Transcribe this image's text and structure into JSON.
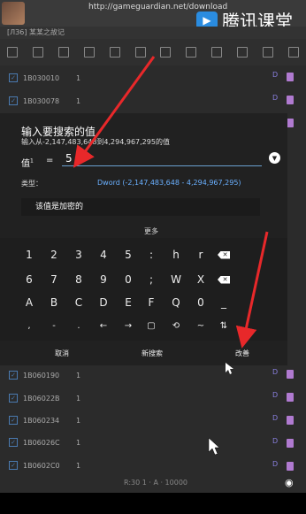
{
  "header": {
    "url": "http://gameguardian.net/download",
    "brand": "腾讯课堂",
    "breadcrumb": "[ЛЗ6] 某某之故记"
  },
  "background_rows": {
    "top": [
      {
        "addr": "1B030010",
        "val": "1"
      },
      {
        "addr": "1B030078",
        "val": "1"
      }
    ],
    "bottom": [
      {
        "addr": "1B060190",
        "val": "1"
      },
      {
        "addr": "1B06022B",
        "val": "1"
      },
      {
        "addr": "1B060234",
        "val": "1"
      },
      {
        "addr": "1B06026C",
        "val": "1"
      },
      {
        "addr": "1B0602C0",
        "val": "1"
      }
    ],
    "side_letter": "D"
  },
  "status": {
    "count": "R:30 1 · A · 10000"
  },
  "dialog": {
    "title": "输入要搜索的值",
    "subtitle": "输入从-2,147,483,648到4,294,967,295的值",
    "value_label": "值",
    "value_sup": "1",
    "equals": "=",
    "value": "5",
    "type_label": "类型：",
    "type_value": "Dword (-2,147,483,648 - 4,294,967,295)",
    "encrypted_label": "该值是加密的",
    "more_label": "更多",
    "keypad_rows": [
      [
        "1",
        "2",
        "3",
        "4",
        "5",
        ":",
        "h",
        "r",
        "⌫"
      ],
      [
        "6",
        "7",
        "8",
        "9",
        "0",
        ";",
        "W",
        "X",
        "⌫"
      ],
      [
        "A",
        "B",
        "C",
        "D",
        "E",
        "F",
        "Q",
        "0",
        "_"
      ],
      [
        ",",
        "-",
        ".",
        "←",
        "→",
        "▢",
        "⟲",
        "~",
        "⇅"
      ]
    ],
    "actions": {
      "cancel": "取消",
      "new_search": "新搜索",
      "modify": "改善"
    },
    "colors": {
      "accent": "#6ab0ff",
      "dialog_bg": "#212121"
    }
  }
}
